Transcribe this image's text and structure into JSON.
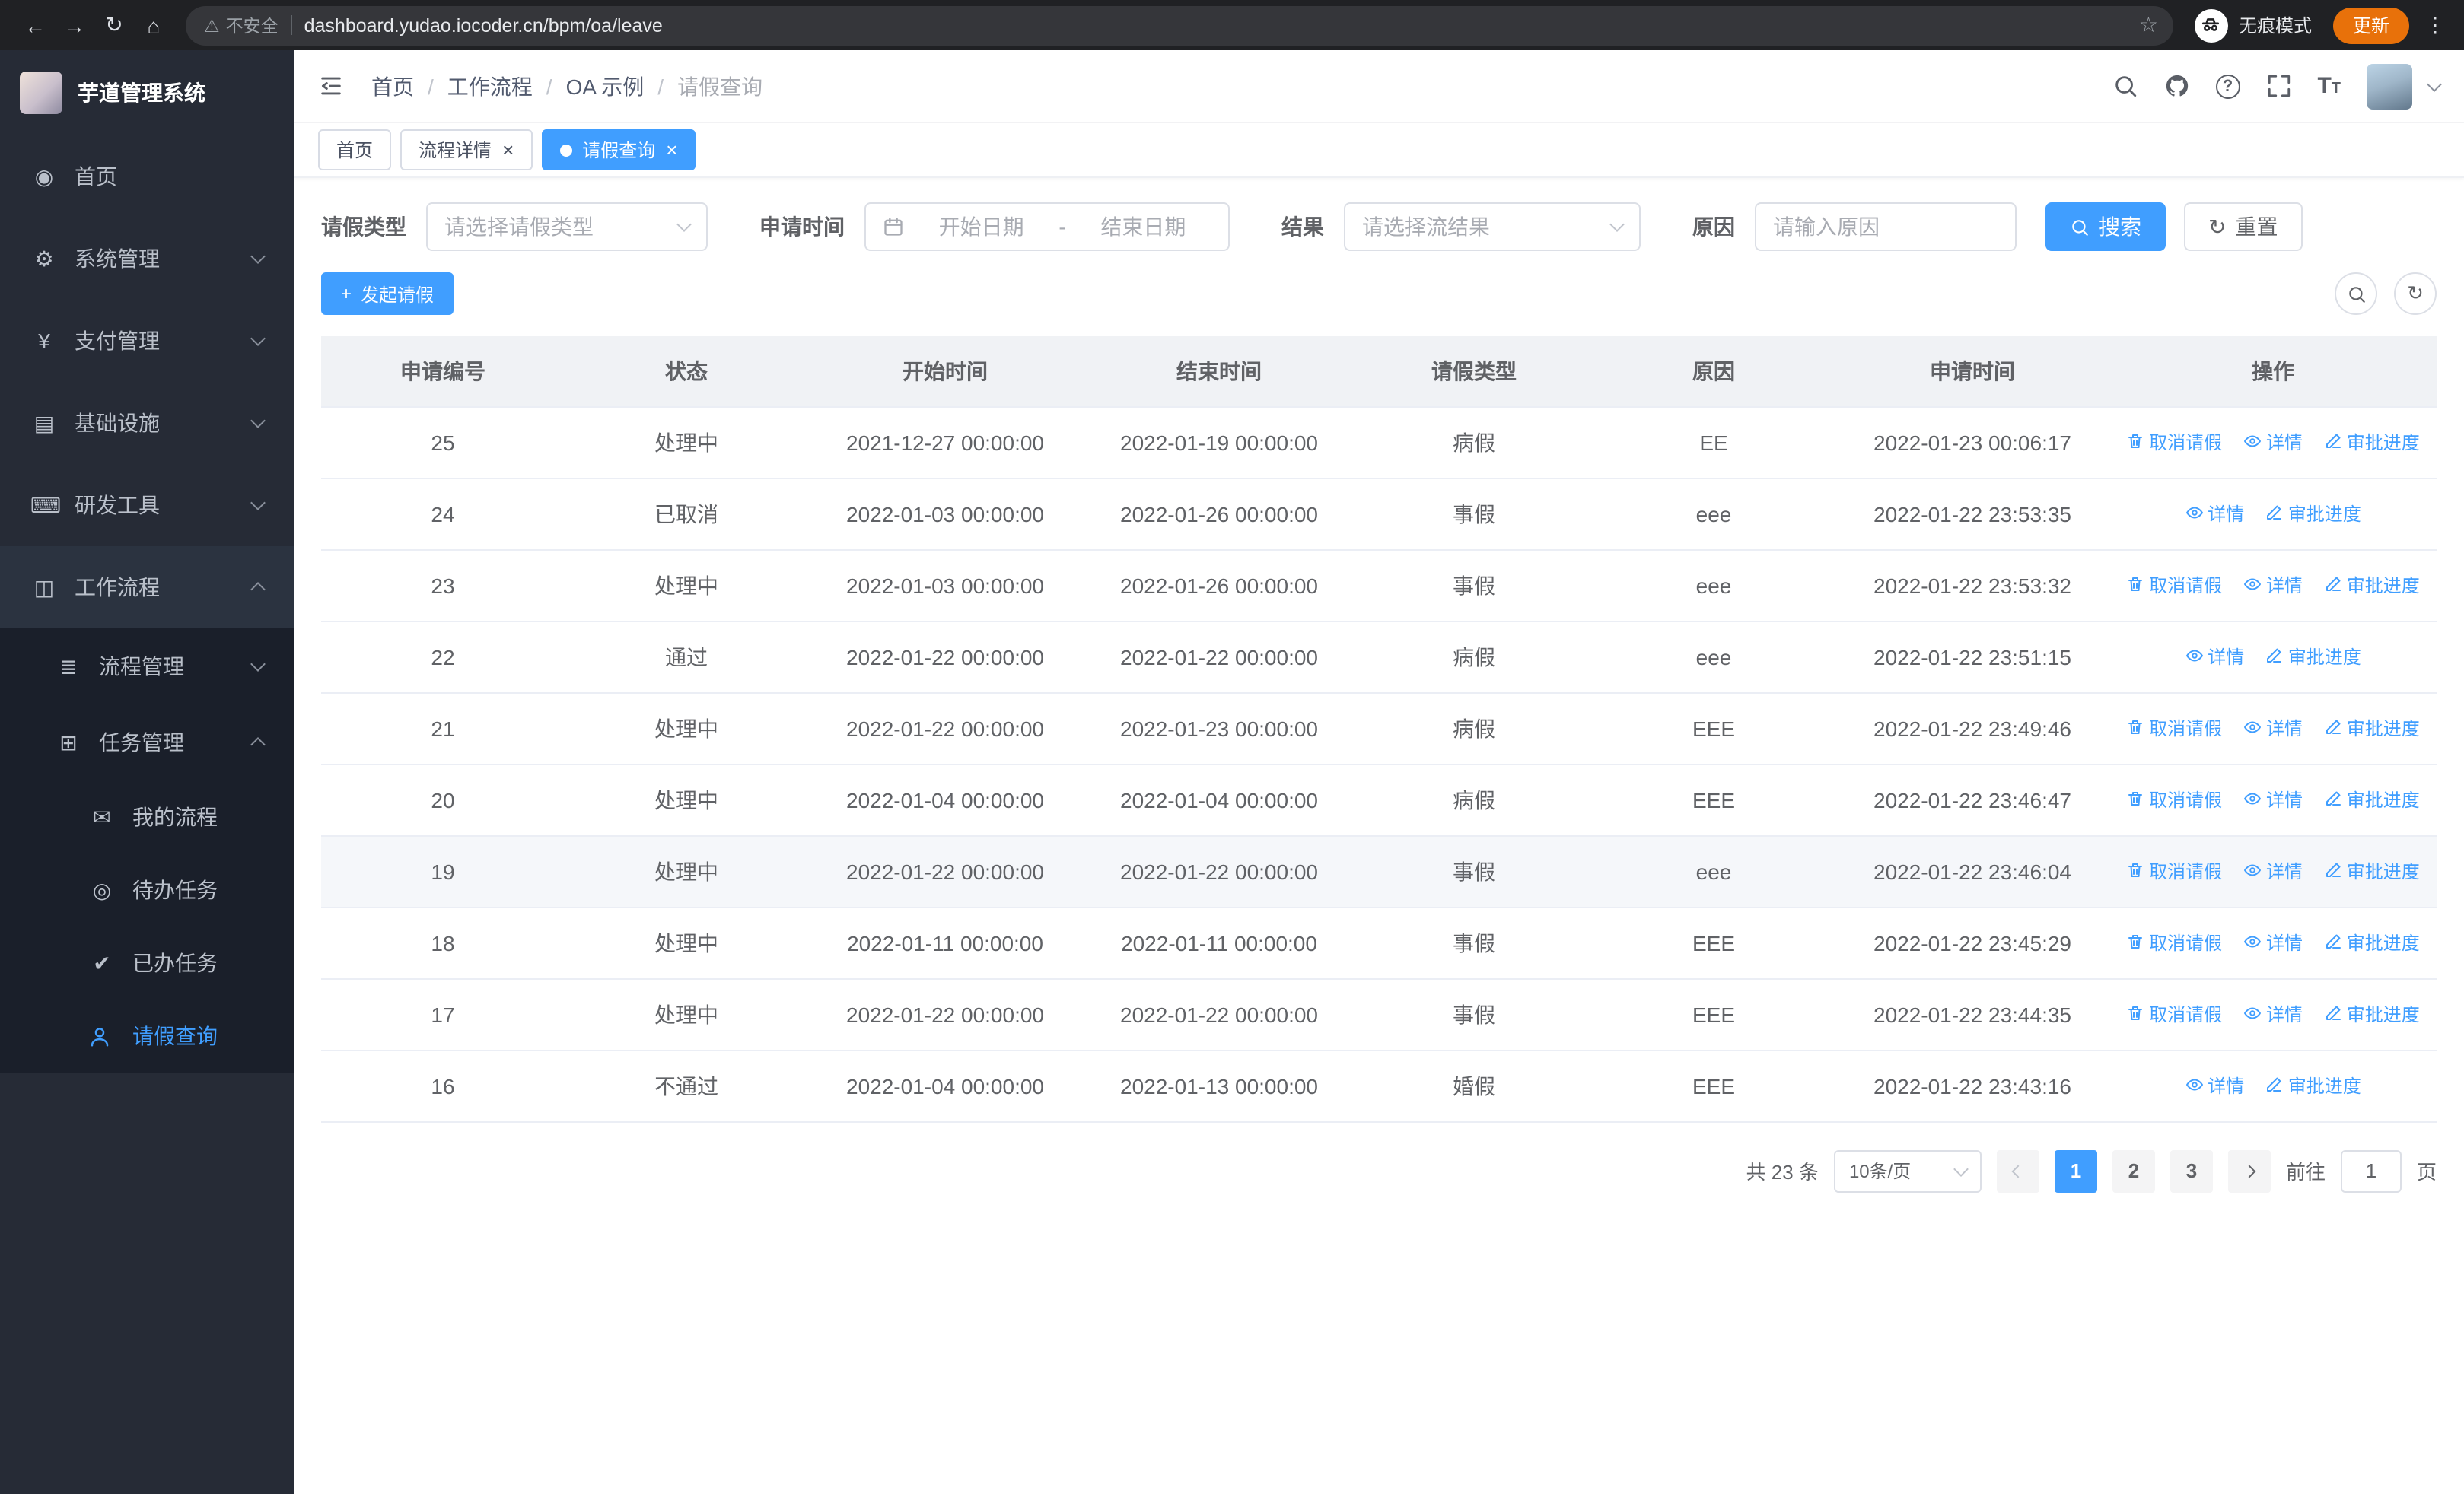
{
  "browser": {
    "security_label": "不安全",
    "url": "dashboard.yudao.iocoder.cn/bpm/oa/leave",
    "incognito_label": "无痕模式",
    "update_label": "更新"
  },
  "icons": {
    "back": "←",
    "forward": "→",
    "reload": "↻",
    "home": "⌂",
    "warning": "⚠",
    "star": "☆",
    "kebab": "⋮",
    "home_menu": "◉",
    "gear": "⚙",
    "yen": "¥",
    "infra": "▤",
    "tools": "⌨",
    "workflow": "◫",
    "list": "≣",
    "task": "⊞",
    "chat": "✉",
    "eye": "◎",
    "done": "✔",
    "close": "×",
    "question": "?",
    "font_big": "T",
    "font_small": "T",
    "plus": "+",
    "refresh": "↻"
  },
  "sidebar": {
    "title": "芋道管理系统",
    "menu": [
      {
        "label": "首页"
      },
      {
        "label": "系统管理"
      },
      {
        "label": "支付管理"
      },
      {
        "label": "基础设施"
      },
      {
        "label": "研发工具"
      },
      {
        "label": "工作流程"
      }
    ],
    "sub": [
      {
        "label": "流程管理"
      },
      {
        "label": "任务管理"
      }
    ],
    "tasks": [
      {
        "label": "我的流程"
      },
      {
        "label": "待办任务"
      },
      {
        "label": "已办任务"
      },
      {
        "label": "请假查询"
      }
    ]
  },
  "breadcrumb": {
    "items": [
      "首页",
      "工作流程",
      "OA 示例",
      "请假查询"
    ],
    "separator": "/"
  },
  "tabs": [
    {
      "label": "首页"
    },
    {
      "label": "流程详情"
    },
    {
      "label": "请假查询"
    }
  ],
  "filters": {
    "leave_type_label": "请假类型",
    "leave_type_placeholder": "请选择请假类型",
    "apply_time_label": "申请时间",
    "start_date_placeholder": "开始日期",
    "range_separator": "-",
    "end_date_placeholder": "结束日期",
    "result_label": "结果",
    "result_placeholder": "请选择流结果",
    "reason_label": "原因",
    "reason_placeholder": "请输入原因",
    "search_label": "搜索",
    "reset_label": "重置"
  },
  "toolbar": {
    "create_label": "发起请假"
  },
  "table": {
    "columns": [
      "申请编号",
      "状态",
      "开始时间",
      "结束时间",
      "请假类型",
      "原因",
      "申请时间",
      "操作"
    ],
    "action_labels": {
      "cancel": "取消请假",
      "detail": "详情",
      "progress": "审批进度"
    },
    "rows": [
      {
        "id": "25",
        "status": "处理中",
        "start_time": "2021-12-27 00:00:00",
        "end_time": "2022-01-19 00:00:00",
        "leave_type": "病假",
        "reason": "EE",
        "apply_time": "2022-01-23 00:06:17",
        "actions": [
          "cancel",
          "detail",
          "progress"
        ],
        "highlight": false
      },
      {
        "id": "24",
        "status": "已取消",
        "start_time": "2022-01-03 00:00:00",
        "end_time": "2022-01-26 00:00:00",
        "leave_type": "事假",
        "reason": "eee",
        "apply_time": "2022-01-22 23:53:35",
        "actions": [
          "detail",
          "progress"
        ],
        "highlight": false
      },
      {
        "id": "23",
        "status": "处理中",
        "start_time": "2022-01-03 00:00:00",
        "end_time": "2022-01-26 00:00:00",
        "leave_type": "事假",
        "reason": "eee",
        "apply_time": "2022-01-22 23:53:32",
        "actions": [
          "cancel",
          "detail",
          "progress"
        ],
        "highlight": false
      },
      {
        "id": "22",
        "status": "通过",
        "start_time": "2022-01-22 00:00:00",
        "end_time": "2022-01-22 00:00:00",
        "leave_type": "病假",
        "reason": "eee",
        "apply_time": "2022-01-22 23:51:15",
        "actions": [
          "detail",
          "progress"
        ],
        "highlight": false
      },
      {
        "id": "21",
        "status": "处理中",
        "start_time": "2022-01-22 00:00:00",
        "end_time": "2022-01-23 00:00:00",
        "leave_type": "病假",
        "reason": "EEE",
        "apply_time": "2022-01-22 23:49:46",
        "actions": [
          "cancel",
          "detail",
          "progress"
        ],
        "highlight": false
      },
      {
        "id": "20",
        "status": "处理中",
        "start_time": "2022-01-04 00:00:00",
        "end_time": "2022-01-04 00:00:00",
        "leave_type": "病假",
        "reason": "EEE",
        "apply_time": "2022-01-22 23:46:47",
        "actions": [
          "cancel",
          "detail",
          "progress"
        ],
        "highlight": false
      },
      {
        "id": "19",
        "status": "处理中",
        "start_time": "2022-01-22 00:00:00",
        "end_time": "2022-01-22 00:00:00",
        "leave_type": "事假",
        "reason": "eee",
        "apply_time": "2022-01-22 23:46:04",
        "actions": [
          "cancel",
          "detail",
          "progress"
        ],
        "highlight": true
      },
      {
        "id": "18",
        "status": "处理中",
        "start_time": "2022-01-11 00:00:00",
        "end_time": "2022-01-11 00:00:00",
        "leave_type": "事假",
        "reason": "EEE",
        "apply_time": "2022-01-22 23:45:29",
        "actions": [
          "cancel",
          "detail",
          "progress"
        ],
        "highlight": false
      },
      {
        "id": "17",
        "status": "处理中",
        "start_time": "2022-01-22 00:00:00",
        "end_time": "2022-01-22 00:00:00",
        "leave_type": "事假",
        "reason": "EEE",
        "apply_time": "2022-01-22 23:44:35",
        "actions": [
          "cancel",
          "detail",
          "progress"
        ],
        "highlight": false
      },
      {
        "id": "16",
        "status": "不通过",
        "start_time": "2022-01-04 00:00:00",
        "end_time": "2022-01-13 00:00:00",
        "leave_type": "婚假",
        "reason": "EEE",
        "apply_time": "2022-01-22 23:43:16",
        "actions": [
          "detail",
          "progress"
        ],
        "highlight": false
      }
    ]
  },
  "pagination": {
    "total": "共 23 条",
    "page_size": "10条/页",
    "pages": [
      "1",
      "2",
      "3"
    ],
    "goto_prefix": "前往",
    "goto_value": "1",
    "goto_suffix": "页"
  }
}
